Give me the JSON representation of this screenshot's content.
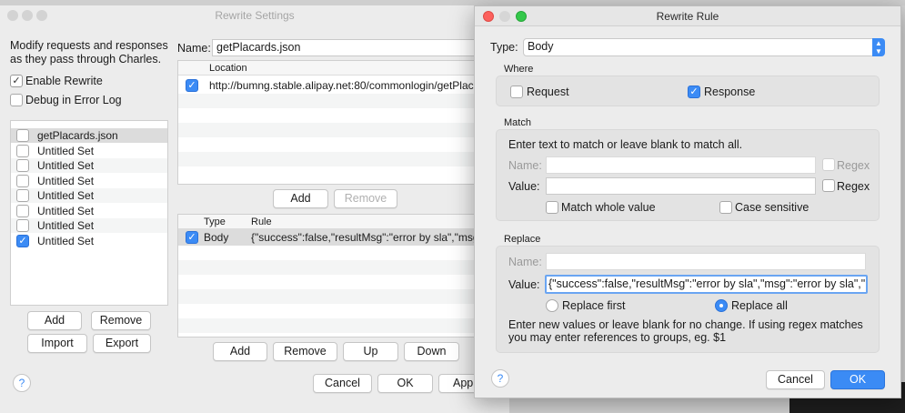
{
  "settings": {
    "title": "Rewrite Settings",
    "intro": "Modify requests and responses as they pass through Charles.",
    "enable_rewrite": "Enable Rewrite",
    "debug_log": "Debug in Error Log",
    "sets": [
      {
        "name": "getPlacards.json",
        "checked": false,
        "selected": true
      },
      {
        "name": "Untitled Set",
        "checked": false,
        "selected": false
      },
      {
        "name": "Untitled Set",
        "checked": false,
        "selected": false
      },
      {
        "name": "Untitled Set",
        "checked": false,
        "selected": false
      },
      {
        "name": "Untitled Set",
        "checked": false,
        "selected": false
      },
      {
        "name": "Untitled Set",
        "checked": false,
        "selected": false
      },
      {
        "name": "Untitled Set",
        "checked": false,
        "selected": false
      },
      {
        "name": "Untitled Set",
        "checked": true,
        "selected": false
      }
    ],
    "add": "Add",
    "remove": "Remove",
    "import": "Import",
    "export": "Export",
    "name_label": "Name:",
    "name_value": "getPlacards.json",
    "location_header": "Location",
    "location_url": "http://bumng.stable.alipay.net:80/commonlogin/getPlac...",
    "loc_add": "Add",
    "loc_remove": "Remove",
    "type_header": "Type",
    "rule_header": "Rule",
    "rule_type": "Body",
    "rule_text": "{\"success\":false,\"resultMsg\":\"error by sla\",\"msg...",
    "rules_add": "Add",
    "rules_remove": "Remove",
    "rules_up": "Up",
    "rules_down": "Down",
    "cancel": "Cancel",
    "ok": "OK",
    "apply": "Appl"
  },
  "rule": {
    "title": "Rewrite Rule",
    "type_label": "Type:",
    "type_value": "Body",
    "where": "Where",
    "request": "Request",
    "response": "Response",
    "match": "Match",
    "match_hint": "Enter text to match or leave blank to match all.",
    "name_label": "Name:",
    "value_label": "Value:",
    "regex": "Regex",
    "match_whole": "Match whole value",
    "case_sensitive": "Case sensitive",
    "replace": "Replace",
    "replace_value": "{\"success\":false,\"resultMsg\":\"error by sla\",\"msg\":\"error by sla\",\"r",
    "replace_first": "Replace first",
    "replace_all": "Replace all",
    "replace_hint_1": "Enter new values or leave blank for no change. If using regex matches",
    "replace_hint_2": "you may enter references to groups, eg. $1",
    "cancel": "Cancel",
    "ok": "OK",
    "help": "?"
  },
  "colors": {
    "accent": "#3b8bf5",
    "close": "#fc605c",
    "minimize": "#fdbc40",
    "zoom": "#34c84a"
  }
}
